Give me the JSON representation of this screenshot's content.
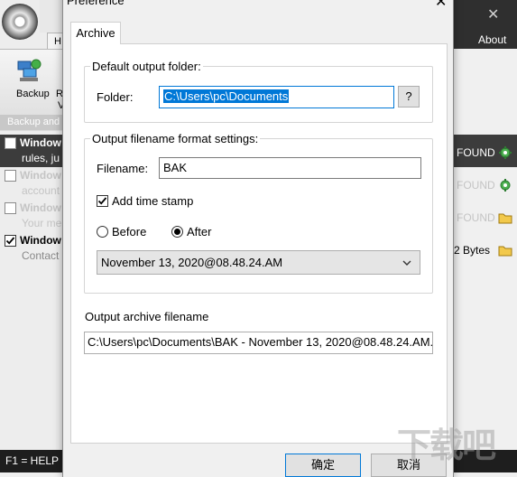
{
  "background_app": {
    "tab_fragment": "H",
    "ribbon": {
      "backup_label": "Backup",
      "r_label": "R",
      "v_label": "V",
      "group_label": "Backup and"
    },
    "about_label": "About",
    "rows": [
      {
        "title": "Window",
        "subtitle": "rules, ju",
        "checked": false,
        "status": "FOUND",
        "icon": "gear-green-icon"
      },
      {
        "title": "Window",
        "subtitle": "account",
        "checked": false,
        "status": "FOUND",
        "icon": "gear-green-icon"
      },
      {
        "title": "Window",
        "subtitle": "Your me",
        "checked": false,
        "status": "FOUND",
        "icon": "folder-icon"
      },
      {
        "title": "Window",
        "subtitle": "Contact",
        "checked": true,
        "status": "2 Bytes",
        "icon": "folder-icon"
      }
    ],
    "statusbar": {
      "help": "F1 = HELP"
    },
    "watermark": "下载吧"
  },
  "dialog": {
    "title": "Preference",
    "tabs": [
      "Archive"
    ],
    "default_output": {
      "legend": "Default output folder:",
      "folder_label": "Folder:",
      "folder_value": "C:\\Users\\pc\\Documents",
      "browse_label": "?"
    },
    "filename_settings": {
      "legend": "Output filename format settings:",
      "filename_label": "Filename:",
      "filename_value": "BAK",
      "add_timestamp_label": "Add time stamp",
      "add_timestamp_checked": true,
      "before_label": "Before",
      "after_label": "After",
      "position_selected": "After",
      "timestamp_value": "November 13, 2020@08.48.24.AM"
    },
    "archive": {
      "label": "Output archive filename",
      "value": "C:\\Users\\pc\\Documents\\BAK - November 13, 2020@08.48.24.AM."
    },
    "ok_label": "确定",
    "cancel_label": "取消"
  },
  "colors": {
    "selection": "#0078d7",
    "dark_bar": "#1e1e1e",
    "header_dark": "#2f2f2f"
  }
}
